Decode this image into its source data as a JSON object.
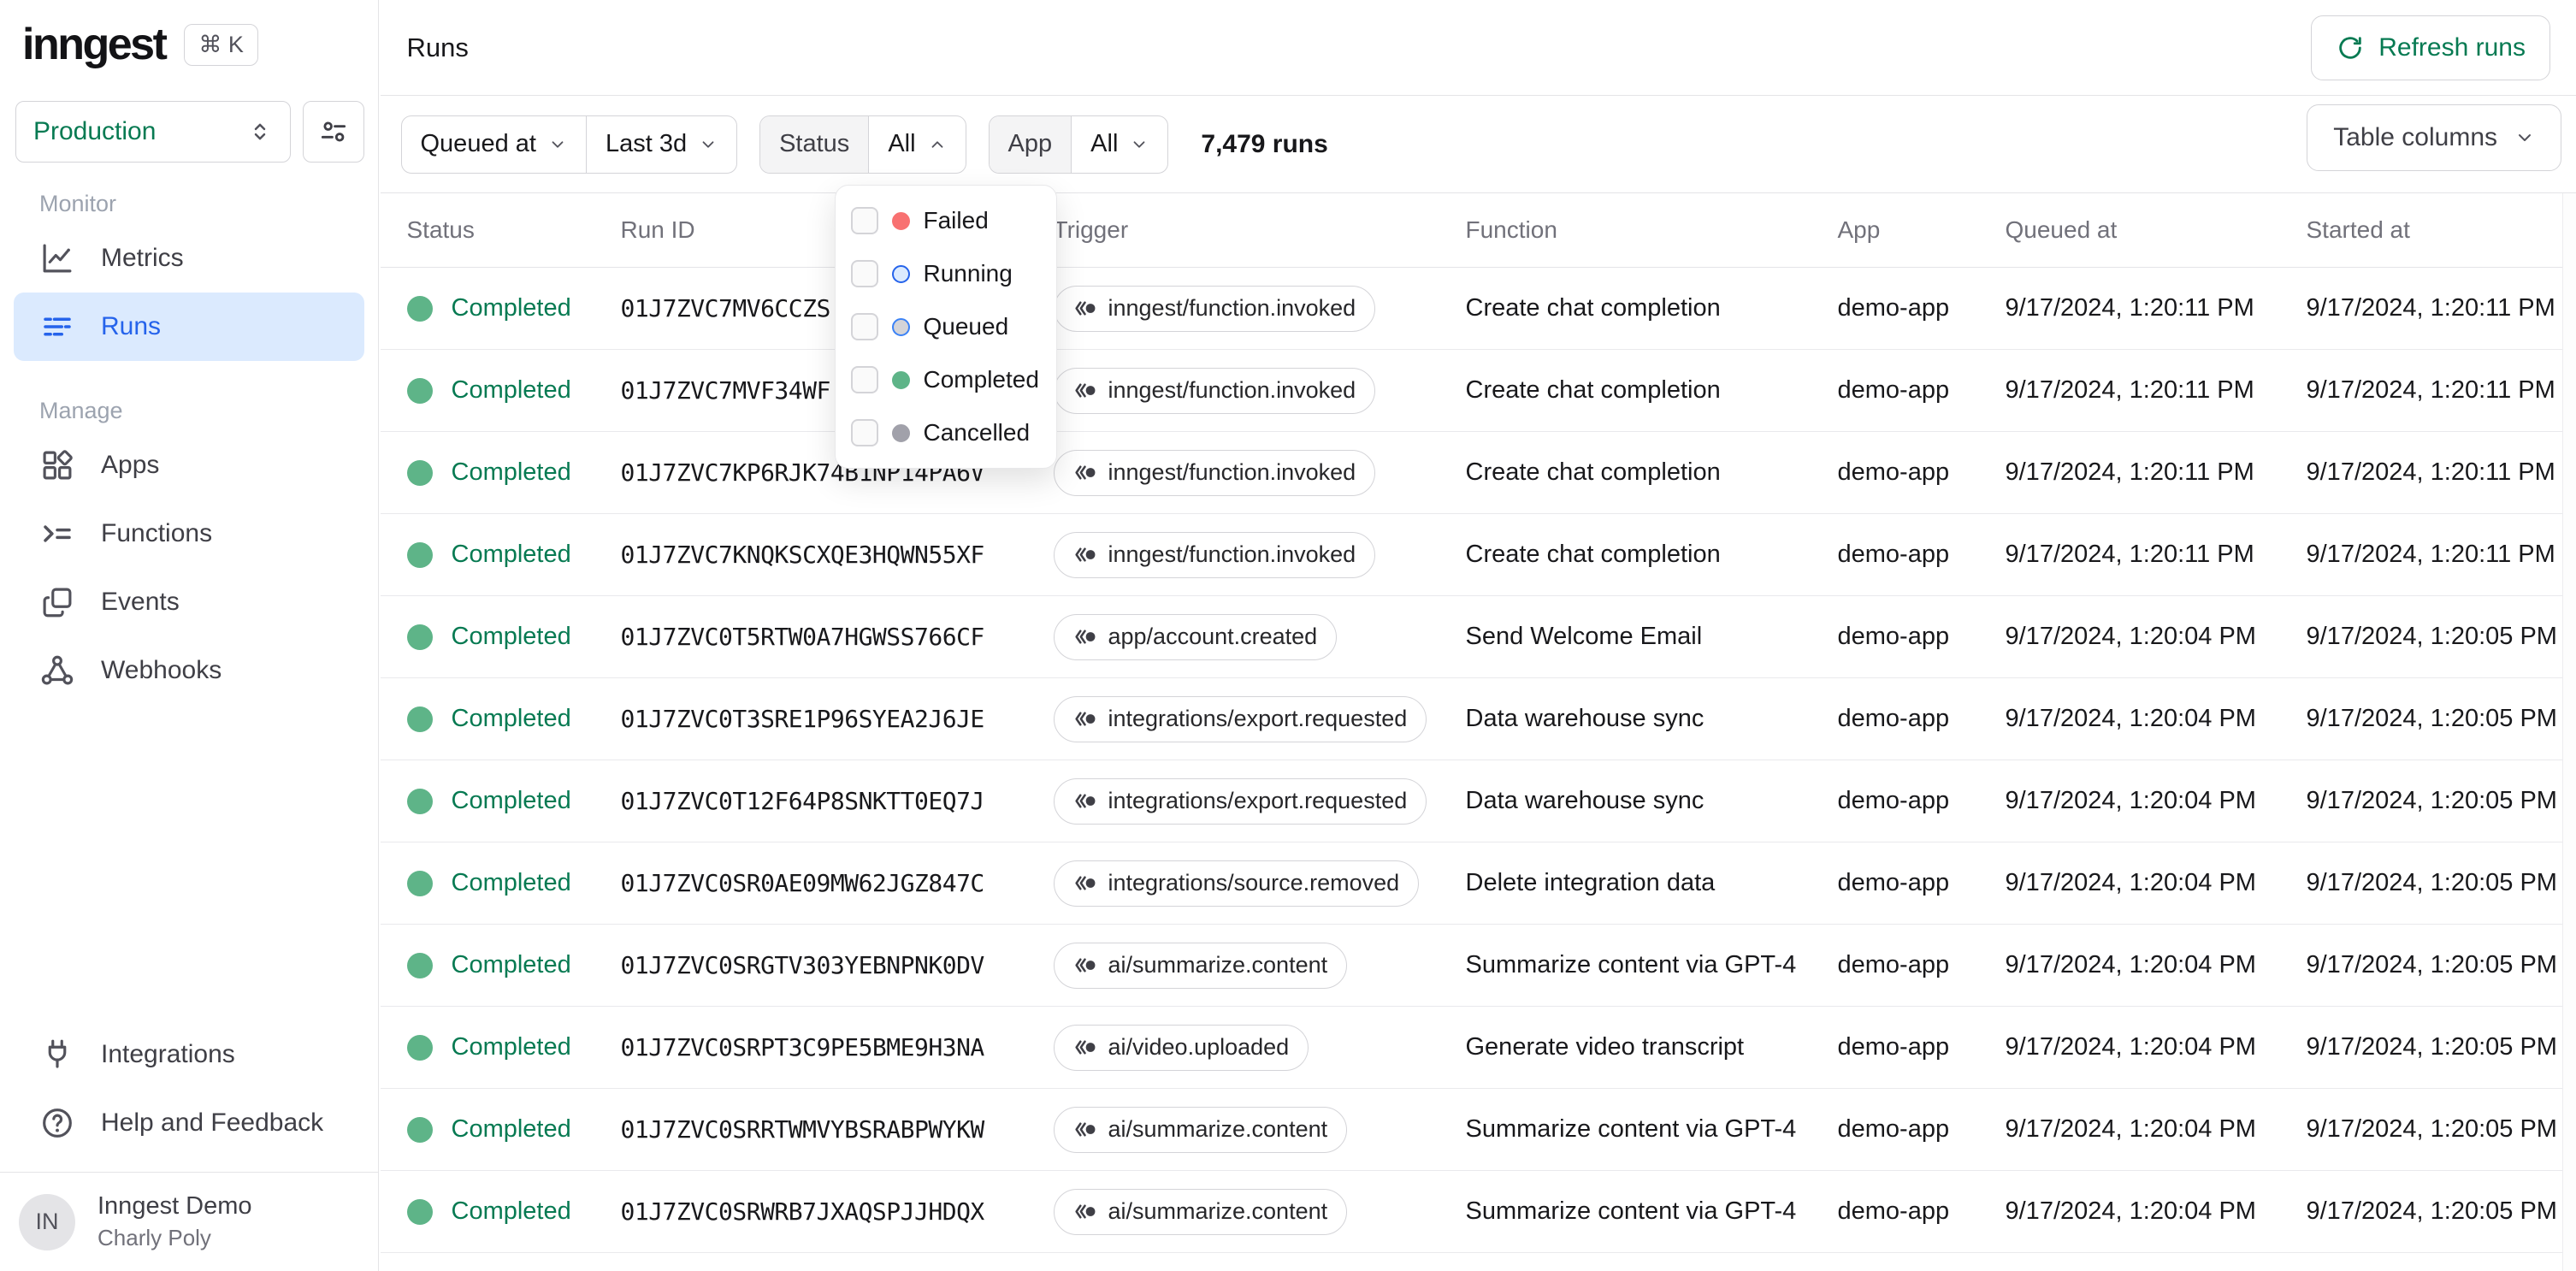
{
  "sidebar": {
    "logo": "inngest",
    "shortcut": "⌘ K",
    "environment": "Production",
    "sections": [
      {
        "label": "Monitor",
        "items": [
          {
            "label": "Metrics",
            "icon": "metrics-icon"
          },
          {
            "label": "Runs",
            "icon": "runs-icon",
            "active": true
          }
        ]
      },
      {
        "label": "Manage",
        "items": [
          {
            "label": "Apps",
            "icon": "apps-icon"
          },
          {
            "label": "Functions",
            "icon": "functions-icon"
          },
          {
            "label": "Events",
            "icon": "events-icon"
          },
          {
            "label": "Webhooks",
            "icon": "webhooks-icon"
          }
        ]
      }
    ],
    "footer_items": [
      {
        "label": "Integrations",
        "icon": "plug-icon"
      },
      {
        "label": "Help and Feedback",
        "icon": "help-icon"
      }
    ],
    "user": {
      "initials": "IN",
      "name": "Inngest Demo",
      "org": "Charly Poly"
    }
  },
  "header": {
    "title": "Runs",
    "refresh_label": "Refresh runs"
  },
  "filters": {
    "field_label": "Queued at",
    "range_label": "Last 3d",
    "status_label": "Status",
    "status_value": "All",
    "app_label": "App",
    "app_value": "All",
    "runs_count": "7,479 runs",
    "table_columns_label": "Table columns"
  },
  "status_dropdown": {
    "options": [
      {
        "label": "Failed",
        "dot_bg": "#f87171",
        "dot_border": "#f87171"
      },
      {
        "label": "Running",
        "dot_bg": "#dbeafe",
        "dot_border": "#2563eb"
      },
      {
        "label": "Queued",
        "dot_bg": "#d4d4d8",
        "dot_border": "#3b82f6"
      },
      {
        "label": "Completed",
        "dot_bg": "#5eb488",
        "dot_border": "#5eb488"
      },
      {
        "label": "Cancelled",
        "dot_bg": "#a1a1aa",
        "dot_border": "#a1a1aa"
      }
    ]
  },
  "table": {
    "columns": [
      "Status",
      "Run ID",
      "Trigger",
      "Function",
      "App",
      "Queued at",
      "Started at"
    ],
    "status_colors": {
      "completed_dot": "#5eb488",
      "completed_text": "#077a52"
    },
    "rows": [
      {
        "status": "Completed",
        "run_id": "01J7ZVC7MV6CCZS",
        "trigger": "inngest/function.invoked",
        "function": "Create chat completion",
        "app": "demo-app",
        "queued_at": "9/17/2024, 1:20:11 PM",
        "started_at": "9/17/2024, 1:20:11 PM"
      },
      {
        "status": "Completed",
        "run_id": "01J7ZVC7MVF34WF",
        "trigger": "inngest/function.invoked",
        "function": "Create chat completion",
        "app": "demo-app",
        "queued_at": "9/17/2024, 1:20:11 PM",
        "started_at": "9/17/2024, 1:20:11 PM"
      },
      {
        "status": "Completed",
        "run_id": "01J7ZVC7KP6RJK74B1NP14PA6V",
        "trigger": "inngest/function.invoked",
        "function": "Create chat completion",
        "app": "demo-app",
        "queued_at": "9/17/2024, 1:20:11 PM",
        "started_at": "9/17/2024, 1:20:11 PM"
      },
      {
        "status": "Completed",
        "run_id": "01J7ZVC7KNQKSCXQE3HQWN55XF",
        "trigger": "inngest/function.invoked",
        "function": "Create chat completion",
        "app": "demo-app",
        "queued_at": "9/17/2024, 1:20:11 PM",
        "started_at": "9/17/2024, 1:20:11 PM"
      },
      {
        "status": "Completed",
        "run_id": "01J7ZVC0T5RTW0A7HGWSS766CF",
        "trigger": "app/account.created",
        "function": "Send Welcome Email",
        "app": "demo-app",
        "queued_at": "9/17/2024, 1:20:04 PM",
        "started_at": "9/17/2024, 1:20:05 PM"
      },
      {
        "status": "Completed",
        "run_id": "01J7ZVC0T3SRE1P96SYEA2J6JE",
        "trigger": "integrations/export.requested",
        "function": "Data warehouse sync",
        "app": "demo-app",
        "queued_at": "9/17/2024, 1:20:04 PM",
        "started_at": "9/17/2024, 1:20:05 PM"
      },
      {
        "status": "Completed",
        "run_id": "01J7ZVC0T12F64P8SNKTT0EQ7J",
        "trigger": "integrations/export.requested",
        "function": "Data warehouse sync",
        "app": "demo-app",
        "queued_at": "9/17/2024, 1:20:04 PM",
        "started_at": "9/17/2024, 1:20:05 PM"
      },
      {
        "status": "Completed",
        "run_id": "01J7ZVC0SR0AE09MW62JGZ847C",
        "trigger": "integrations/source.removed",
        "function": "Delete integration data",
        "app": "demo-app",
        "queued_at": "9/17/2024, 1:20:04 PM",
        "started_at": "9/17/2024, 1:20:05 PM"
      },
      {
        "status": "Completed",
        "run_id": "01J7ZVC0SRGTV303YEBNPNK0DV",
        "trigger": "ai/summarize.content",
        "function": "Summarize content via GPT-4",
        "app": "demo-app",
        "queued_at": "9/17/2024, 1:20:04 PM",
        "started_at": "9/17/2024, 1:20:05 PM"
      },
      {
        "status": "Completed",
        "run_id": "01J7ZVC0SRPT3C9PE5BME9H3NA",
        "trigger": "ai/video.uploaded",
        "function": "Generate video transcript",
        "app": "demo-app",
        "queued_at": "9/17/2024, 1:20:04 PM",
        "started_at": "9/17/2024, 1:20:05 PM"
      },
      {
        "status": "Completed",
        "run_id": "01J7ZVC0SRRTWMVYBSRABPWYKW",
        "trigger": "ai/summarize.content",
        "function": "Summarize content via GPT-4",
        "app": "demo-app",
        "queued_at": "9/17/2024, 1:20:04 PM",
        "started_at": "9/17/2024, 1:20:05 PM"
      },
      {
        "status": "Completed",
        "run_id": "01J7ZVC0SRWRB7JXAQSPJJHDQX",
        "trigger": "ai/summarize.content",
        "function": "Summarize content via GPT-4",
        "app": "demo-app",
        "queued_at": "9/17/2024, 1:20:04 PM",
        "started_at": "9/17/2024, 1:20:05 PM"
      }
    ]
  },
  "colors": {
    "accent_green": "#077a52",
    "accent_blue": "#2563eb",
    "active_item_bg": "#dbeafe",
    "completed_dot": "#5eb488"
  }
}
